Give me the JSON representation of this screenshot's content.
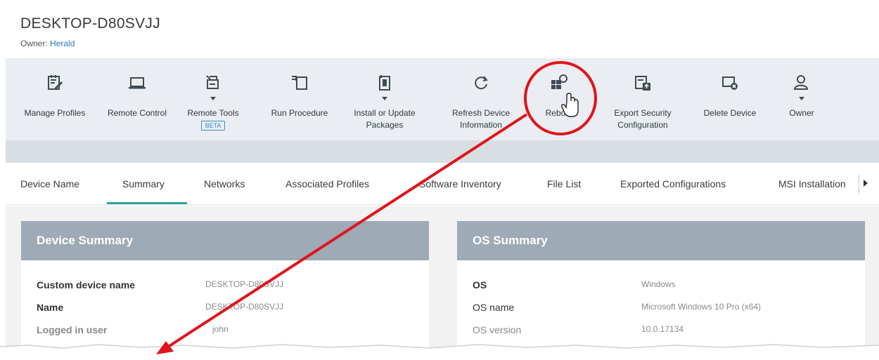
{
  "header": {
    "device_name": "DESKTOP-D80SVJJ",
    "owner_label": "Owner:",
    "owner_name": "Herald"
  },
  "toolbar": {
    "items": [
      {
        "label": "Manage Profiles",
        "icon": "manage-profiles-icon"
      },
      {
        "label": "Remote Control",
        "icon": "laptop-icon"
      },
      {
        "label": "Remote Tools",
        "icon": "remote-tools-icon",
        "badge": "BETA"
      },
      {
        "label": "Run Procedure",
        "icon": "run-procedure-icon"
      },
      {
        "label_line1": "Install or Update",
        "label_line2": "Packages",
        "icon": "install-packages-icon"
      },
      {
        "label_line1": "Refresh Device",
        "label_line2": "Information",
        "icon": "refresh-icon"
      },
      {
        "label": "Reboot",
        "icon": "reboot-icon"
      },
      {
        "label_line1": "Export Security",
        "label_line2": "Configuration",
        "icon": "export-config-icon"
      },
      {
        "label": "Delete Device",
        "icon": "delete-device-icon"
      },
      {
        "label": "Owner",
        "icon": "owner-icon"
      }
    ]
  },
  "tabs": {
    "items": [
      "Device Name",
      "Summary",
      "Networks",
      "Associated Profiles",
      "Software Inventory",
      "File List",
      "Exported Configurations",
      "MSI Installation"
    ],
    "active": "Summary"
  },
  "device_summary": {
    "title": "Device Summary",
    "rows": [
      {
        "key": "Custom device name",
        "value": "DESKTOP-D80SVJJ"
      },
      {
        "key": "Name",
        "value": "DESKTOP-D80SVJJ"
      },
      {
        "key": "Logged in user",
        "value": "john"
      }
    ]
  },
  "os_summary": {
    "title": "OS Summary",
    "rows": [
      {
        "key": "OS",
        "value": "Windows"
      },
      {
        "key": "OS name",
        "value": "Microsoft Windows 10 Pro (x64)"
      },
      {
        "key": "OS version",
        "value": "10.0.17134"
      }
    ]
  },
  "colors": {
    "toolbar_bg": "#eaedf1",
    "card_header": "#9eaab5",
    "tab_accent": "#2aa39a",
    "link": "#2a7ab8",
    "annotation": "#e0141b"
  }
}
